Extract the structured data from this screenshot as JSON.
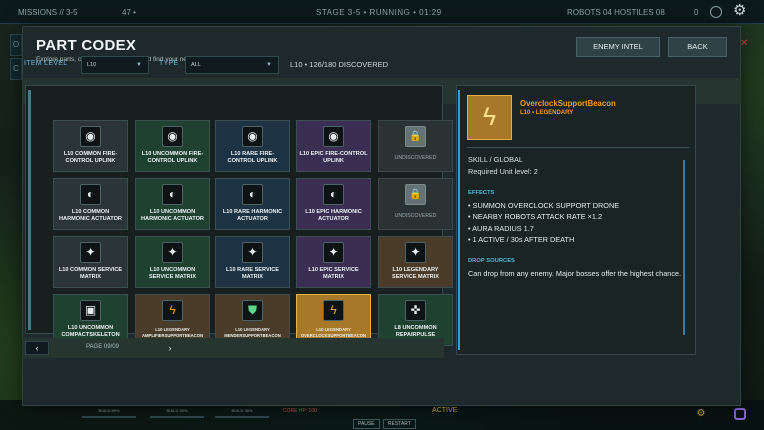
{
  "hud": {
    "missions": "MISSIONS // 3-5",
    "count": "47 •",
    "stage_status": "STAGE 3-5  •  RUNNING  •  01:29",
    "robots_hostiles": "ROBOTS 04   HOSTILES 08",
    "zero": "0",
    "side_o": "O",
    "side_c": "C",
    "close": "✕",
    "build_1": "BUILD 89%",
    "build_2": "BUILD 49%",
    "build_3": "BUILD 38%",
    "core": "CORE HP: 100",
    "pause": "PAUSE",
    "restart": "RESTART",
    "active": "ACTIVE",
    "icon_left": "⚙"
  },
  "modal": {
    "title": "PART CODEX",
    "subtitle": "Explore parts, compare their effects and find your next unlock.",
    "enemy_intel": "ENEMY INTEL",
    "back": "BACK"
  },
  "filters": {
    "item_level_label": "ITEM LEVEL",
    "item_level_value": "L10",
    "type_label": "TYPE",
    "type_value": "ALL",
    "caret": "▼",
    "discovered": "L10 • 126/180 DISCOVERED"
  },
  "tiles": [
    {
      "name": "L10 COMMON FIRE-CONTROL UPLINK",
      "icon": "◉",
      "icon_name": "uplink-icon"
    },
    {
      "name": "L10 UNCOMMON FIRE-CONTROL UPLINK",
      "icon": "◉",
      "icon_name": "uplink-icon"
    },
    {
      "name": "L10 RARE FIRE-CONTROL UPLINK",
      "icon": "◉",
      "icon_name": "uplink-icon"
    },
    {
      "name": "L10 EPIC FIRE-CONTROL UPLINK",
      "icon": "◉",
      "icon_name": "uplink-icon"
    },
    {
      "name": "UNDISCOVERED",
      "icon": "🔒",
      "icon_name": "lock-icon"
    },
    {
      "name": "L10 COMMON HARMONIC ACTUATOR",
      "icon": "◐",
      "icon_name": "actuator-icon"
    },
    {
      "name": "L10 UNCOMMON HARMONIC ACTUATOR",
      "icon": "◐",
      "icon_name": "actuator-icon"
    },
    {
      "name": "L10 RARE HARMONIC ACTUATOR",
      "icon": "◐",
      "icon_name": "actuator-icon"
    },
    {
      "name": "L10 EPIC HARMONIC ACTUATOR",
      "icon": "◐",
      "icon_name": "actuator-icon"
    },
    {
      "name": "UNDISCOVERED",
      "icon": "🔒",
      "icon_name": "lock-icon"
    },
    {
      "name": "L10 COMMON SERVICE MATRIX",
      "icon": "✦",
      "icon_name": "service-matrix-icon"
    },
    {
      "name": "L10 UNCOMMON SERVICE MATRIX",
      "icon": "✦",
      "icon_name": "service-matrix-icon"
    },
    {
      "name": "L10 RARE SERVICE MATRIX",
      "icon": "✦",
      "icon_name": "service-matrix-icon"
    },
    {
      "name": "L10 EPIC SERVICE MATRIX",
      "icon": "✦",
      "icon_name": "service-matrix-icon"
    },
    {
      "name": "L10 LEGENDARY SERVICE MATRIX",
      "icon": "✦",
      "icon_name": "service-matrix-icon"
    },
    {
      "name": "L10 UNCOMMON COMPACTSKELETON",
      "icon": "▣",
      "icon_name": "skeleton-icon"
    },
    {
      "name": "L10 LEGENDARY AMPLIFIERSUPPORTBEACON",
      "icon": "ϟ",
      "icon_name": "bolt-icon"
    },
    {
      "name": "L10 LEGENDARY MENDERSUPPORTBEACON",
      "icon": "⛊",
      "icon_name": "shield-icon"
    },
    {
      "name": "L10 LEGENDARY OVERCLOCKSUPPORTBEACON",
      "icon": "ϟ",
      "icon_name": "bolt-icon"
    },
    {
      "name": "L8 UNCOMMON REPAIRPULSE",
      "icon": "✜",
      "icon_name": "repair-icon"
    }
  ],
  "pager": {
    "prev": "‹",
    "next": "›",
    "label": "PAGE 09/09"
  },
  "detail": {
    "icon": "ϟ",
    "name": "OverclockSupportBeacon",
    "rarity": "L10  •  LEGENDARY",
    "skill": "SKILL / GLOBAL",
    "required": "Required Unit level: 2",
    "effects_header": "EFFECTS",
    "effects": [
      "• SUMMON OVERCLOCK SUPPORT DRONE",
      "• NEARBY ROBOTS ATTACK RATE ×1.2",
      "• AURA RADIUS 1.7",
      "• 1 ACTIVE / 30s AFTER DEATH"
    ],
    "drop_header": "DROP SOURCES",
    "drop_text": "Can drop from any enemy. Major bosses offer the highest chance."
  },
  "colors": {
    "legendary_accent": "#f19a22",
    "section_header": "#4fb4d6",
    "panel_bg": "#1d292a",
    "selected_tile": "#a77827"
  }
}
